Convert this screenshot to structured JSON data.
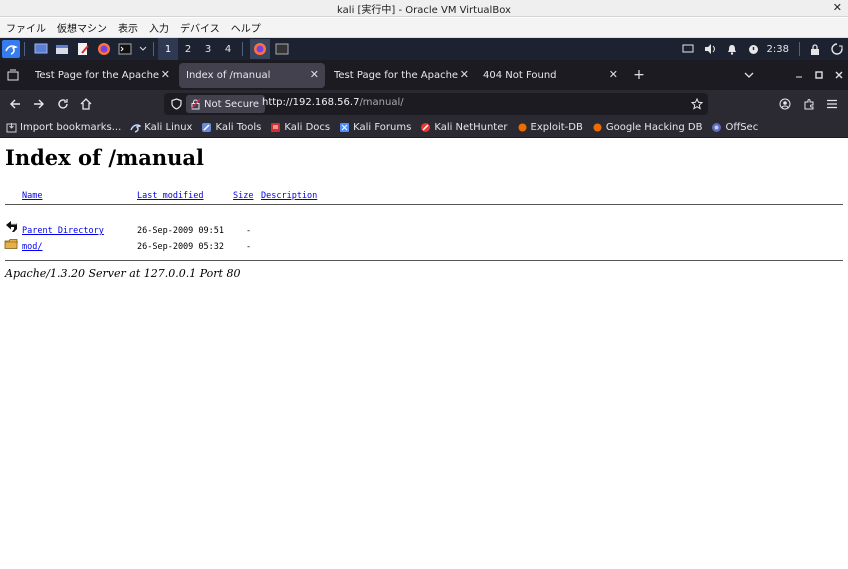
{
  "window": {
    "title": "kali [実行中] - Oracle VM VirtualBox",
    "close": "✕"
  },
  "vbox_menu": [
    "ファイル",
    "仮想マシン",
    "表示",
    "入力",
    "デバイス",
    "ヘルプ"
  ],
  "panel": {
    "workspaces": [
      "1",
      "2",
      "3",
      "4"
    ],
    "active_workspace": "1",
    "clock": "2:38"
  },
  "tabs": [
    {
      "label": "Test Page for the Apache Web",
      "active": false
    },
    {
      "label": "Index of /manual",
      "active": true
    },
    {
      "label": "Test Page for the Apache Web",
      "active": false
    },
    {
      "label": "404 Not Found",
      "active": false
    }
  ],
  "tab_close": "✕",
  "new_tab": "+",
  "url": {
    "security": "Not Secure",
    "host": "http://192.168.56.7",
    "path": "/manual/"
  },
  "bookmarks": [
    {
      "label": "Import bookmarks...",
      "icon": "import-icon",
      "color": "#cfcfd8"
    },
    {
      "label": "Kali Linux",
      "icon": "kali-dragon-icon",
      "color": "#367bf0"
    },
    {
      "label": "Kali Tools",
      "icon": "kali-tools-icon",
      "color": "#6a8bd8"
    },
    {
      "label": "Kali Docs",
      "icon": "kali-docs-icon",
      "color": "#d32f2f"
    },
    {
      "label": "Kali Forums",
      "icon": "kali-forums-icon",
      "color": "#4f8ef7"
    },
    {
      "label": "Kali NetHunter",
      "icon": "nethunter-icon",
      "color": "#e53935"
    },
    {
      "label": "Exploit-DB",
      "icon": "exploit-db-icon",
      "color": "#ef6c00"
    },
    {
      "label": "Google Hacking DB",
      "icon": "ghdb-icon",
      "color": "#ef6c00"
    },
    {
      "label": "OffSec",
      "icon": "offsec-icon",
      "color": "#5c6bc0"
    }
  ],
  "page": {
    "title": "Index of /manual",
    "columns": [
      "Name",
      "Last modified",
      "Size",
      "Description"
    ],
    "rows": [
      {
        "icon": "back-arrow-icon",
        "name": "Parent Directory",
        "modified": "26-Sep-2009 09:51",
        "size": "-"
      },
      {
        "icon": "folder-icon",
        "name": "mod/",
        "modified": "26-Sep-2009 05:32",
        "size": "-"
      }
    ],
    "address": "Apache/1.3.20 Server at 127.0.0.1 Port 80"
  }
}
